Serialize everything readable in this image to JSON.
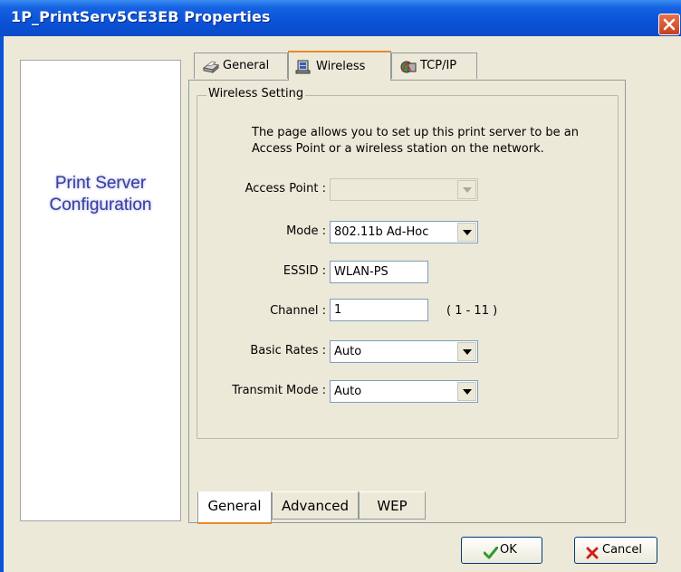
{
  "window": {
    "title": "1P_PrintServ5CE3EB Properties"
  },
  "sidebar": {
    "line1": "Print Server",
    "line2": "Configuration"
  },
  "tabs": [
    {
      "label": "General",
      "icon": "printer-icon"
    },
    {
      "label": "Wireless",
      "icon": "wireless-icon"
    },
    {
      "label": "TCP/IP",
      "icon": "network-icon"
    }
  ],
  "wireless": {
    "group_title": "Wireless Setting",
    "description_line1": "The page allows you to set up this print server to be an",
    "description_line2": "Access Point or a wireless station on the network.",
    "access_point_label": "Access Point :",
    "access_point_value": "",
    "mode_label": "Mode :",
    "mode_value": "802.11b Ad-Hoc",
    "essid_label": "ESSID :",
    "essid_value": "WLAN-PS",
    "channel_label": "Channel :",
    "channel_value": "1",
    "channel_range": "( 1 - 11 )",
    "basic_rates_label": "Basic Rates :",
    "basic_rates_value": "Auto",
    "transmit_mode_label": "Transmit Mode :",
    "transmit_mode_value": "Auto"
  },
  "bottom_tabs": [
    "General",
    "Advanced",
    "WEP"
  ],
  "buttons": {
    "ok": "OK",
    "cancel": "Cancel"
  },
  "colors": {
    "titlebar": "#0a52d8",
    "tab_highlight": "#e68b2c",
    "sidebar_text": "#3a3fa0"
  }
}
